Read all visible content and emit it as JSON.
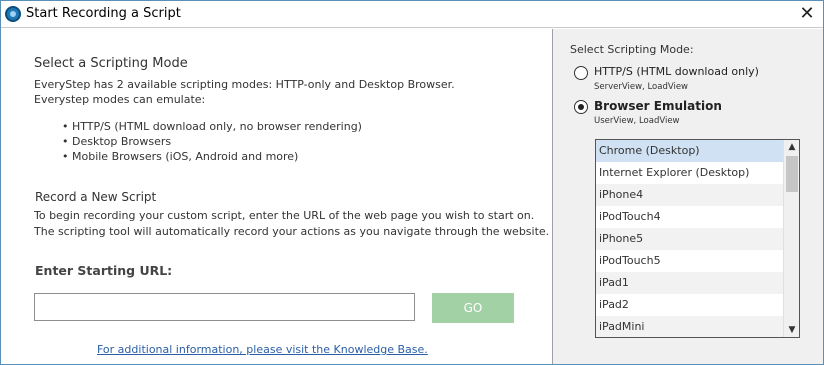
{
  "window": {
    "title": "Start Recording a Script",
    "close_symbol": "✕"
  },
  "left": {
    "mode_heading": "Select a Scripting Mode",
    "mode_desc_line1": "EveryStep has 2 available scripting modes: HTTP-only and Desktop Browser.",
    "mode_desc_line2": "Everystep modes can emulate:",
    "bullets": [
      "• HTTP/S (HTML download only, no browser rendering)",
      "• Desktop Browsers",
      "• Mobile Browsers (iOS, Android and more)"
    ],
    "record_heading": "Record a New Script",
    "record_desc_line1": "To begin recording your custom script, enter the URL of the web page you wish to start on.",
    "record_desc_line2": "The scripting tool will automatically record your actions as you navigate through the website.",
    "url_label": "Enter Starting URL:",
    "url_value": "",
    "go_label": "GO",
    "kb_link": "For additional information, please visit the Knowledge Base."
  },
  "right": {
    "heading": "Select Scripting Mode:",
    "options": [
      {
        "label": "HTTP/S (HTML download only)",
        "sub": "ServerView, LoadView",
        "checked": false
      },
      {
        "label": "Browser Emulation",
        "sub": "UserView, LoadView",
        "checked": true
      }
    ],
    "browsers": [
      "Chrome (Desktop)",
      "Internet Explorer (Desktop)",
      "iPhone4",
      "iPodTouch4",
      "iPhone5",
      "iPodTouch5",
      "iPad1",
      "iPad2",
      "iPadMini"
    ],
    "selected_browser": "Chrome (Desktop)",
    "scroll_up_symbol": "▲",
    "scroll_down_symbol": "▼"
  },
  "colors": {
    "go_button": "#a3d1a6",
    "link": "#2b5ea8",
    "selected_item": "#cfe1f3",
    "right_panel_bg": "#f0f0f0"
  }
}
